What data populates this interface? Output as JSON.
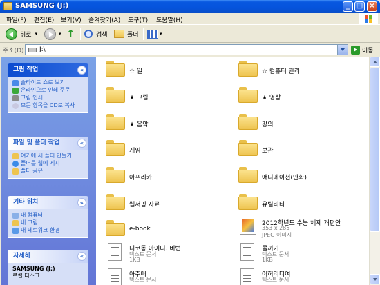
{
  "window": {
    "title": "SAMSUNG (J:)"
  },
  "menu": [
    "파일(F)",
    "편집(E)",
    "보기(V)",
    "즐겨찾기(A)",
    "도구(T)",
    "도움말(H)"
  ],
  "toolbar": {
    "back": "뒤로",
    "search": "검색",
    "folders": "폴더"
  },
  "address": {
    "label": "주소(D)",
    "value": "J:\\",
    "go": "이동"
  },
  "tasks": {
    "picture": {
      "title": "그림 작업",
      "items": [
        "슬라이드 쇼로 보기",
        "온라인으로 인쇄 주문",
        "그림 인쇄",
        "모든 항목을 CD로 복사"
      ]
    },
    "file_folder": {
      "title": "파일 및 폴더 작업",
      "items": [
        "여기에 새 폴더 만들기",
        "폴더를 웹에 게시",
        "폴더 공유"
      ]
    },
    "other": {
      "title": "기타 위치",
      "items": [
        "내 컴퓨터",
        "내 그림",
        "내 네트워크 환경"
      ]
    },
    "details": {
      "title": "자세히",
      "name": "SAMSUNG (J:)",
      "type": "로컬 디스크"
    }
  },
  "files": [
    {
      "name": "☆ 일",
      "kind": "folder"
    },
    {
      "name": "☆ 컴퓨터 관리",
      "kind": "folder"
    },
    {
      "name": "★ 그림",
      "kind": "folder"
    },
    {
      "name": "★ 영상",
      "kind": "folder"
    },
    {
      "name": "★ 음악",
      "kind": "folder"
    },
    {
      "name": "강의",
      "kind": "folder"
    },
    {
      "name": "게임",
      "kind": "folder"
    },
    {
      "name": "보관",
      "kind": "folder"
    },
    {
      "name": "아프리카",
      "kind": "folder"
    },
    {
      "name": "애니메이션(만화)",
      "kind": "folder"
    },
    {
      "name": "웹서핑 자료",
      "kind": "folder"
    },
    {
      "name": "유틸리티",
      "kind": "folder"
    },
    {
      "name": "e-book",
      "kind": "folder"
    },
    {
      "name": "2012학년도 수능 체제 개편안",
      "kind": "image",
      "line2": "353 x 285",
      "line3": "JPEG 이미지"
    },
    {
      "name": "니코동 아이디. 비번",
      "kind": "text",
      "line2": "텍스트 문서",
      "line3": "1KB"
    },
    {
      "name": "몰끼기",
      "kind": "text",
      "line2": "텍스트 문서",
      "line3": "1KB"
    },
    {
      "name": "아주매",
      "kind": "text",
      "line2": "텍스트 문서",
      "line3": ""
    },
    {
      "name": "어허리디여",
      "kind": "text",
      "line2": "텍스트 문서",
      "line3": ""
    }
  ]
}
